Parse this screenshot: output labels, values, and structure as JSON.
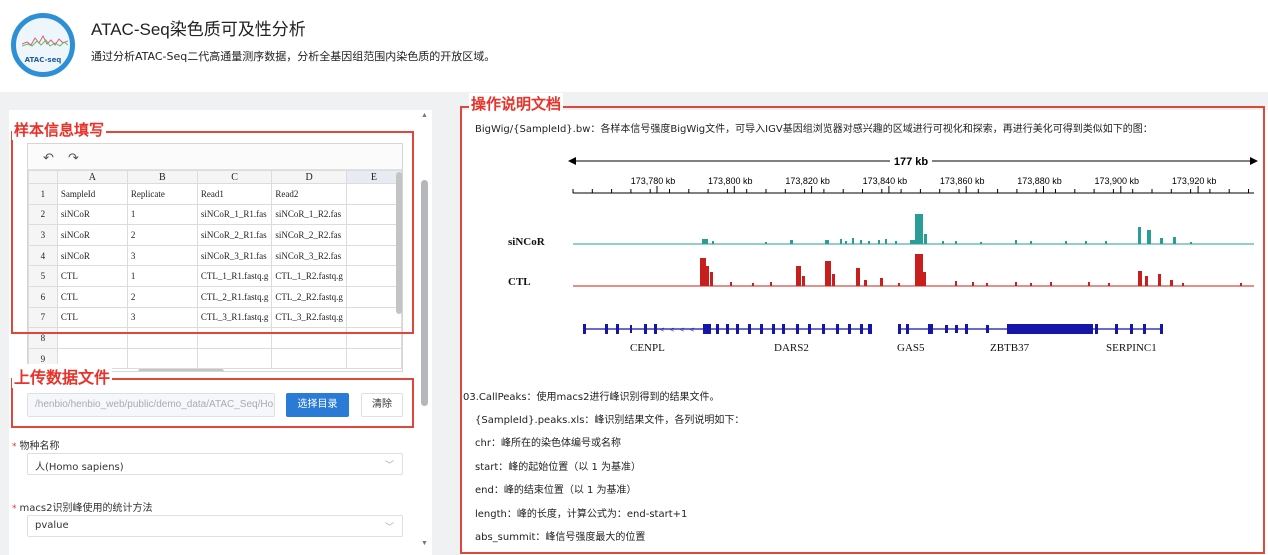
{
  "header": {
    "logo_text": "ATAC-seq",
    "title": "ATAC-Seq染色质可及性分析",
    "description": "通过分析ATAC-Seq二代高通量测序数据，分析全基因组范围内染色质的开放区域。"
  },
  "annotations": {
    "sample_info": "样本信息填写",
    "upload": "上传数据文件",
    "doc": "操作说明文档"
  },
  "sheet": {
    "undo_icon": "↶",
    "redo_icon": "↷",
    "columns": [
      "A",
      "B",
      "C",
      "D",
      "E"
    ],
    "rows": [
      {
        "num": "1",
        "cells": [
          "SampleId",
          "Replicate",
          "Read1",
          "Read2",
          ""
        ]
      },
      {
        "num": "2",
        "cells": [
          "siNCoR",
          "1",
          "siNCoR_1_R1.fas",
          "siNCoR_1_R2.fas",
          ""
        ]
      },
      {
        "num": "3",
        "cells": [
          "siNCoR",
          "2",
          "siNCoR_2_R1.fas",
          "siNCoR_2_R2.fas",
          ""
        ]
      },
      {
        "num": "4",
        "cells": [
          "siNCoR",
          "3",
          "siNCoR_3_R1.fas",
          "siNCoR_3_R2.fas",
          ""
        ]
      },
      {
        "num": "5",
        "cells": [
          "CTL",
          "1",
          "CTL_1_R1.fastq.g",
          "CTL_1_R2.fastq.g",
          ""
        ]
      },
      {
        "num": "6",
        "cells": [
          "CTL",
          "2",
          "CTL_2_R1.fastq.g",
          "CTL_2_R2.fastq.g",
          ""
        ]
      },
      {
        "num": "7",
        "cells": [
          "CTL",
          "3",
          "CTL_3_R1.fastq.g",
          "CTL_3_R2.fastq.g",
          ""
        ]
      },
      {
        "num": "8",
        "cells": [
          "",
          "",
          "",
          "",
          ""
        ]
      },
      {
        "num": "9",
        "cells": [
          "",
          "",
          "",
          "",
          ""
        ]
      }
    ]
  },
  "upload": {
    "path_value": "/henbio/henbio_web/public/demo_data/ATAC_Seq/Ho",
    "select_dir_label": "选择目录",
    "clear_label": "清除"
  },
  "form": {
    "species_label": "物种名称",
    "species_value": "人(Homo sapiens)",
    "method_label": "macs2识别峰使用的统计方法",
    "method_value": "pvalue",
    "required_mark": "*"
  },
  "doc": {
    "bigwig_line": "BigWig/{SampleId}.bw：各样本信号强度BigWig文件，可导入IGV基因组浏览器对感兴趣的区域进行可视化和探索，再进行美化可得到类似如下的图：",
    "callpeaks_line": "03.CallPeaks：使用macs2进行峰识别得到的结果文件。",
    "peaks_xls_line": "{SampleId}.peaks.xls：峰识别结果文件，各列说明如下：",
    "chr_line": "chr：峰所在的染色体编号或名称",
    "start_line": "start：峰的起始位置（以 1 为基准）",
    "end_line": "end：峰的结束位置（以 1 为基准）",
    "length_line": "length：峰的长度，计算公式为：end-start+1",
    "abs_summit_line": "abs_summit：峰信号强度最大的位置"
  },
  "browser": {
    "span_label": "177 kb",
    "ticks": [
      "173,780 kb",
      "173,800 kb",
      "173,820 kb",
      "173,840 kb",
      "173,860 kb",
      "173,880 kb",
      "173,900 kb",
      "173,920 kb"
    ],
    "tracks": [
      {
        "name": "siNCoR",
        "color": "#2a9d96"
      },
      {
        "name": "CTL",
        "color": "#c81e1e"
      }
    ],
    "genes": [
      "CENPL",
      "DARS2",
      "GAS5",
      "ZBTB37",
      "SERPINC1"
    ],
    "gene_color": "#1515a8"
  },
  "colors": {
    "annotation_red": "#e8322a",
    "primary_blue": "#2a7bd6"
  }
}
